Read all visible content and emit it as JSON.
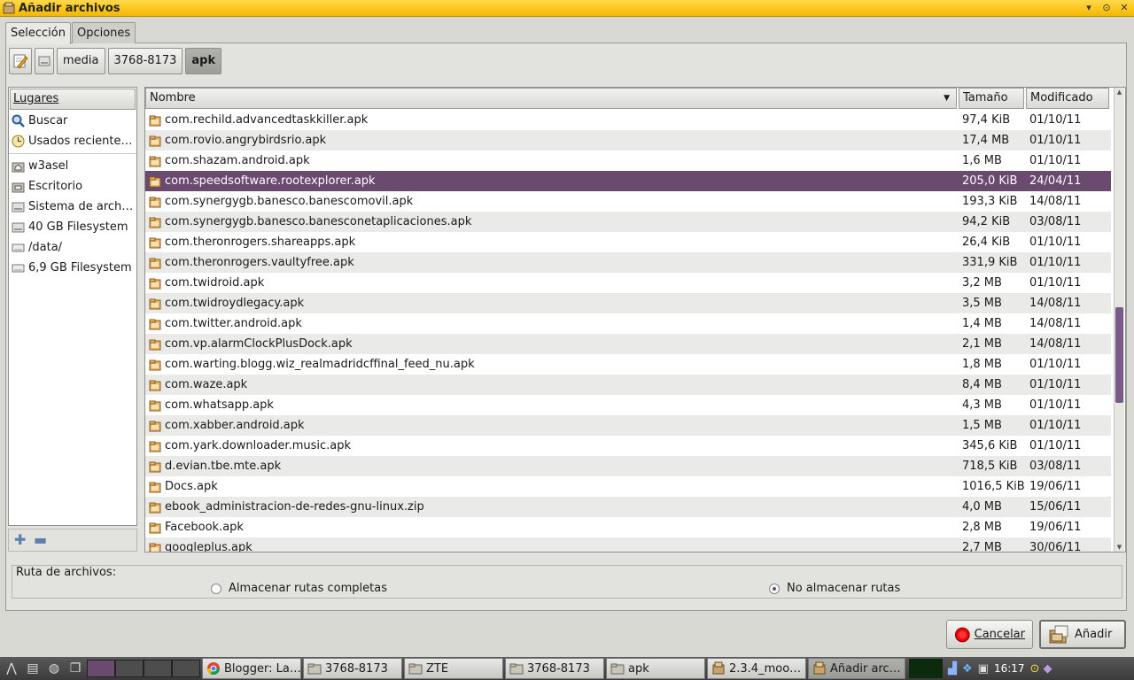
{
  "window": {
    "title": "Añadir archivos"
  },
  "tabs": [
    {
      "label": "Selección",
      "active": true
    },
    {
      "label": "Opciones",
      "active": false
    }
  ],
  "pathbar": {
    "segments": [
      "media",
      "3768-8173",
      "apk"
    ],
    "active": "apk"
  },
  "places": {
    "header": "Lugares",
    "items": [
      {
        "label": "Buscar",
        "icon": "search-icon"
      },
      {
        "label": "Usados reciente…",
        "icon": "clock-icon"
      },
      {
        "label": "w3asel",
        "icon": "home-folder-icon"
      },
      {
        "label": "Escritorio",
        "icon": "desktop-folder-icon"
      },
      {
        "label": "Sistema de arch…",
        "icon": "drive-icon"
      },
      {
        "label": "40 GB Filesystem",
        "icon": "drive-icon"
      },
      {
        "label": "/data/",
        "icon": "removable-drive-icon"
      },
      {
        "label": "6,9 GB Filesystem",
        "icon": "removable-drive-icon"
      }
    ]
  },
  "files": {
    "columns": {
      "name": "Nombre",
      "size": "Tamaño",
      "modified": "Modificado"
    },
    "rows": [
      {
        "name": "com.rechild.advancedtaskkiller.apk",
        "size": "97,4 KiB",
        "modified": "01/10/11"
      },
      {
        "name": "com.rovio.angrybirdsrio.apk",
        "size": "17,4 MB",
        "modified": "01/10/11"
      },
      {
        "name": "com.shazam.android.apk",
        "size": "1,6 MB",
        "modified": "01/10/11"
      },
      {
        "name": "com.speedsoftware.rootexplorer.apk",
        "size": "205,0 KiB",
        "modified": "24/04/11",
        "selected": true
      },
      {
        "name": "com.synergygb.banesco.banescomovil.apk",
        "size": "193,3 KiB",
        "modified": "14/08/11"
      },
      {
        "name": "com.synergygb.banesco.banesconetaplicaciones.apk",
        "size": "94,2 KiB",
        "modified": "03/08/11"
      },
      {
        "name": "com.theronrogers.shareapps.apk",
        "size": "26,4 KiB",
        "modified": "01/10/11"
      },
      {
        "name": "com.theronrogers.vaultyfree.apk",
        "size": "331,9 KiB",
        "modified": "01/10/11"
      },
      {
        "name": "com.twidroid.apk",
        "size": "3,2 MB",
        "modified": "01/10/11"
      },
      {
        "name": "com.twidroydlegacy.apk",
        "size": "3,5 MB",
        "modified": "14/08/11"
      },
      {
        "name": "com.twitter.android.apk",
        "size": "1,4 MB",
        "modified": "14/08/11"
      },
      {
        "name": "com.vp.alarmClockPlusDock.apk",
        "size": "2,1 MB",
        "modified": "14/08/11"
      },
      {
        "name": "com.warting.blogg.wiz_realmadridcffinal_feed_nu.apk",
        "size": "1,8 MB",
        "modified": "01/10/11"
      },
      {
        "name": "com.waze.apk",
        "size": "8,4 MB",
        "modified": "01/10/11"
      },
      {
        "name": "com.whatsapp.apk",
        "size": "4,3 MB",
        "modified": "01/10/11"
      },
      {
        "name": "com.xabber.android.apk",
        "size": "1,5 MB",
        "modified": "01/10/11"
      },
      {
        "name": "com.yark.downloader.music.apk",
        "size": "345,6 KiB",
        "modified": "01/10/11"
      },
      {
        "name": "d.evian.tbe.mte.apk",
        "size": "718,5 KiB",
        "modified": "03/08/11"
      },
      {
        "name": "Docs.apk",
        "size": "1016,5 KiB",
        "modified": "19/06/11"
      },
      {
        "name": "ebook_administracion-de-redes-gnu-linux.zip",
        "size": "4,0 MB",
        "modified": "15/06/11"
      },
      {
        "name": "Facebook.apk",
        "size": "2,8 MB",
        "modified": "19/06/11"
      },
      {
        "name": "googleplus.apk",
        "size": "2,7 MB",
        "modified": "30/06/11"
      }
    ]
  },
  "ruta": {
    "legend": "Ruta de archivos:",
    "options": [
      {
        "label": "Almacenar rutas completas",
        "checked": false
      },
      {
        "label": "No almacenar rutas",
        "checked": true
      }
    ]
  },
  "buttons": {
    "cancel": "Cancelar",
    "add": "Añadir"
  },
  "taskbar": {
    "tasks": [
      {
        "label": "Blogger: La…",
        "icon": "chrome-icon"
      },
      {
        "label": "3768-8173",
        "icon": "folder-icon"
      },
      {
        "label": "ZTE",
        "icon": "folder-icon"
      },
      {
        "label": "3768-8173",
        "icon": "folder-icon"
      },
      {
        "label": "apk",
        "icon": "folder-icon"
      },
      {
        "label": "2.3.4_moo…",
        "icon": "archiver-icon"
      },
      {
        "label": "Añadir arc…",
        "icon": "archiver-icon",
        "active": true
      }
    ],
    "clock": "16:17"
  },
  "colors": {
    "accent": "#6b4a70",
    "titlebar": "#f5c21a"
  }
}
